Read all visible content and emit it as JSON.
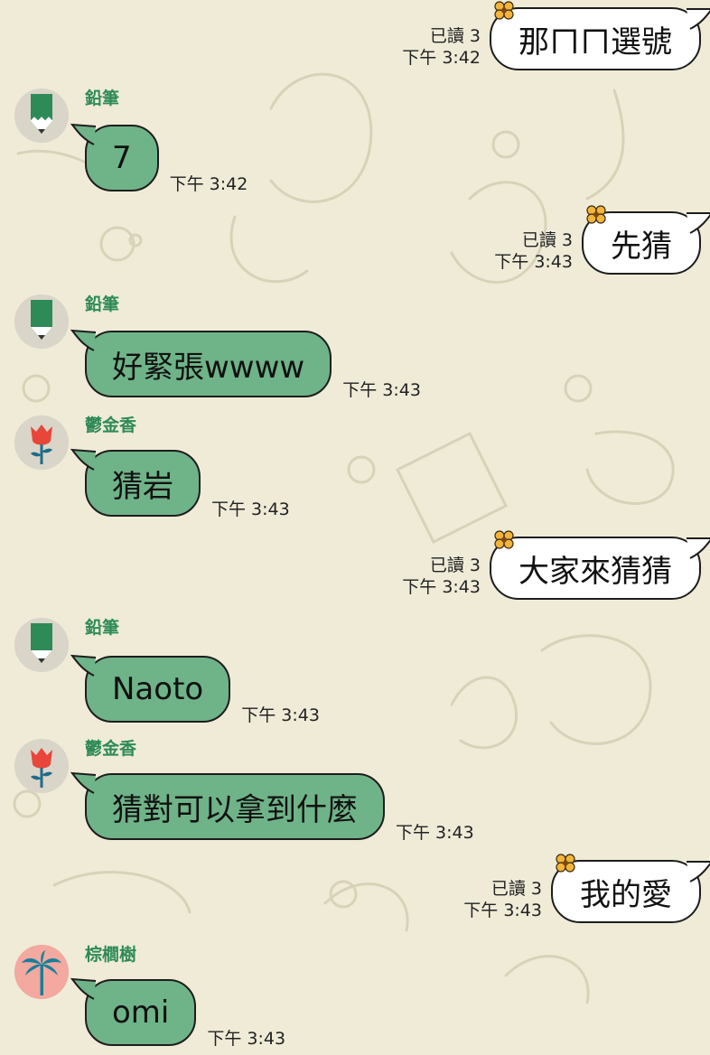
{
  "messages": [
    {
      "dir": "out",
      "text": "那ㄇㄇ選號",
      "read": "已讀 3",
      "time": "下午 3:42"
    },
    {
      "dir": "in",
      "sender": "鉛筆",
      "avatar": "pencil-avatar",
      "text": "7",
      "time": "下午 3:42"
    },
    {
      "dir": "out",
      "text": "先猜",
      "read": "已讀 3",
      "time": "下午 3:43"
    },
    {
      "dir": "in",
      "sender": "鉛筆",
      "avatar": "pencil-avatar",
      "text": "好緊張wwww",
      "time": "下午 3:43"
    },
    {
      "dir": "in",
      "sender": "鬱金香",
      "avatar": "tulip-avatar",
      "text": "猜岩",
      "time": "下午 3:43"
    },
    {
      "dir": "out",
      "text": "大家來猜猜",
      "read": "已讀 3",
      "time": "下午 3:43"
    },
    {
      "dir": "in",
      "sender": "鉛筆",
      "avatar": "pencil-avatar",
      "text": "Naoto",
      "time": "下午 3:43"
    },
    {
      "dir": "in",
      "sender": "鬱金香",
      "avatar": "tulip-avatar",
      "text": "猜對可以拿到什麼",
      "time": "下午 3:43"
    },
    {
      "dir": "out",
      "text": "我的愛",
      "read": "已讀 3",
      "time": "下午 3:43"
    },
    {
      "dir": "in",
      "sender": "棕櫚樹",
      "avatar": "palm-tree-avatar",
      "text": "omi",
      "time": "下午 3:43"
    }
  ],
  "colors": {
    "background": "#efebd7",
    "incoming_bubble": "#6fb388",
    "outgoing_bubble": "#ffffff",
    "sender_name": "#2e8a57"
  }
}
